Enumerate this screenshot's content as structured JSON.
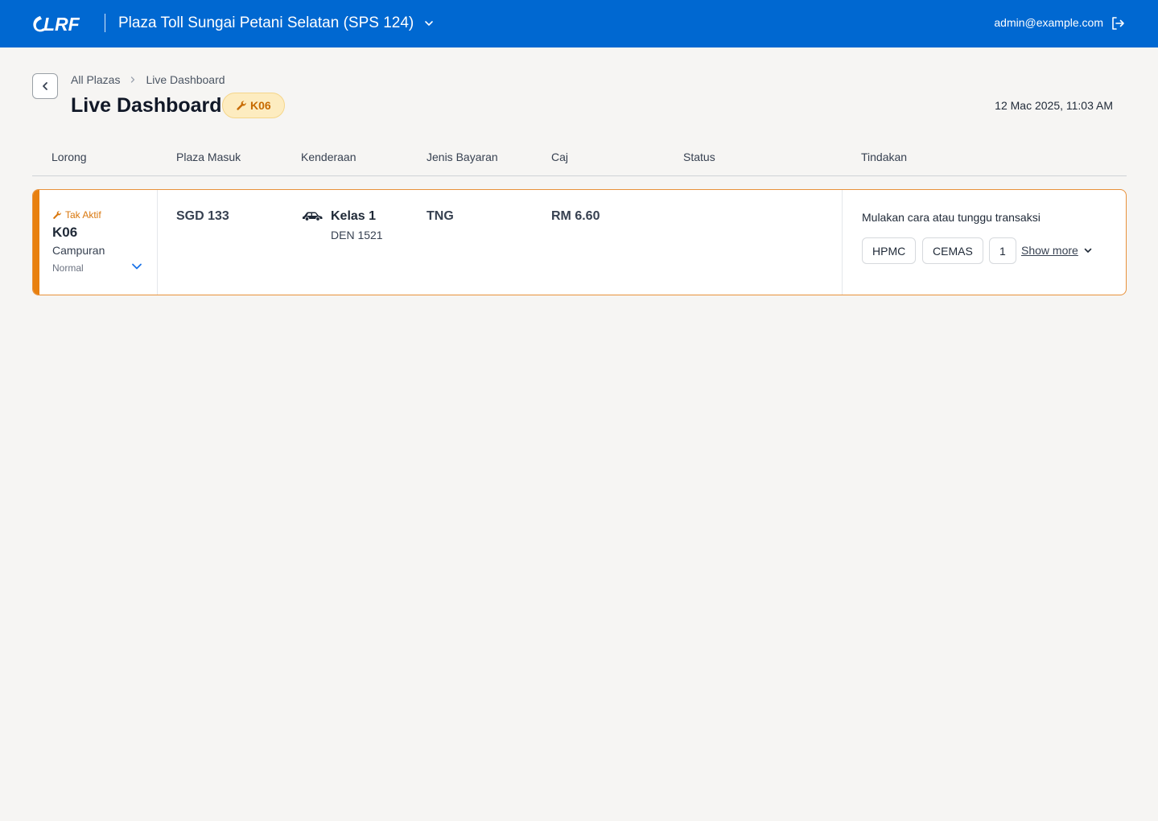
{
  "header": {
    "logo_text": "LRF",
    "plaza_title": "Plaza Toll Sungai Petani Selatan (SPS 124)",
    "user_email": "admin@example.com",
    "colors": {
      "bar": "#0068d1",
      "text": "#ffffff"
    }
  },
  "breadcrumb": {
    "items": [
      "All Plazas",
      "Live Dashboard"
    ]
  },
  "page": {
    "title": "Live Dashboard",
    "lane_badge": "K06",
    "datetime": "12 Mac 2025, 11:03 AM"
  },
  "table": {
    "columns": [
      "Lorong",
      "Plaza Masuk",
      "Kenderaan",
      "Jenis Bayaran",
      "Caj",
      "Status",
      "Tindakan"
    ],
    "rows": [
      {
        "lane_status": "Tak Aktif",
        "lane_code": "K06",
        "lane_type": "Campuran",
        "lane_mode": "Normal",
        "entry_plaza": "SGD 133",
        "vehicle_icon": "car-icon",
        "vehicle_class": "Kelas 1",
        "vehicle_plate": "DEN 1521",
        "payment_type": "TNG",
        "charge": "RM 6.60",
        "status": "",
        "action_message": "Mulakan cara atau tunggu transaksi",
        "action_buttons": [
          "HPMC",
          "CEMAS",
          "1"
        ],
        "show_more_label": "Show more"
      }
    ]
  },
  "colors": {
    "accent_warning": "#e8800f",
    "badge_bg": "#fdecc0",
    "page_bg": "#f6f5f3"
  }
}
